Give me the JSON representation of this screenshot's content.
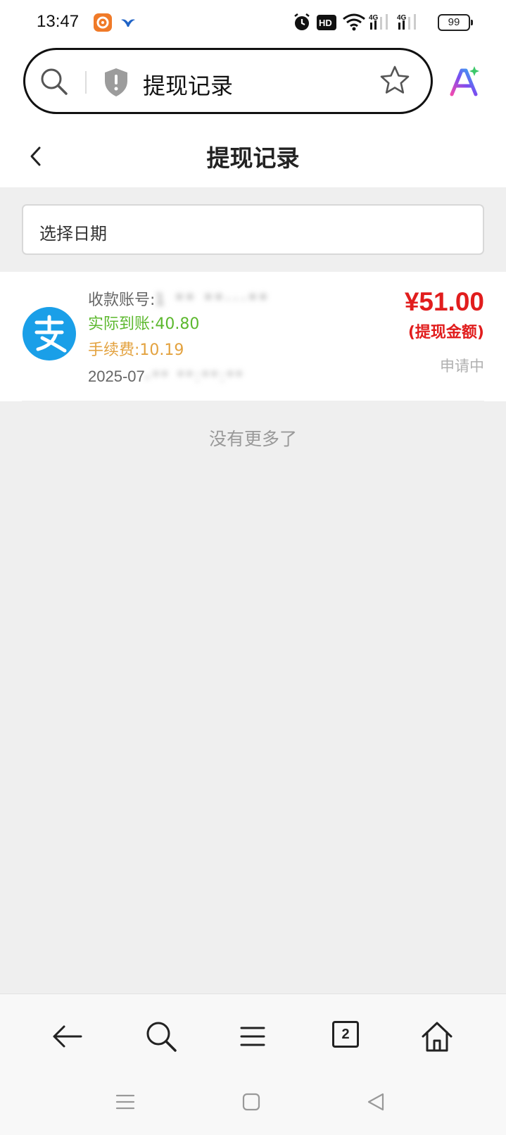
{
  "status_bar": {
    "time": "13:47",
    "battery": "99",
    "icons": [
      "app-notification-icon",
      "bird-notification-icon",
      "alarm-icon",
      "hd-icon",
      "wifi-icon",
      "signal-4g-icon",
      "signal-4g-icon"
    ],
    "hd_label": "HD",
    "net_label_1": "4G",
    "net_label_2": "4G"
  },
  "browser": {
    "address_text": "提现记录",
    "tab_count": "2"
  },
  "page": {
    "title": "提现记录",
    "date_placeholder": "选择日期"
  },
  "record": {
    "account_label": "收款账号:",
    "account_value": "1 ** **···**",
    "actual_label": "实际到账:",
    "actual_value": "40.80",
    "fee_label": "手续费:",
    "fee_value": "10.19",
    "date_prefix": "2025-07",
    "date_blurred": "-** **:**:**",
    "amount": "¥51.00",
    "amount_label": "(提现金额)",
    "status": "申请中"
  },
  "footer": {
    "no_more": "没有更多了"
  },
  "colors": {
    "amount_red": "#e11d1d",
    "actual_green": "#5cb82e",
    "fee_orange": "#e3a23f",
    "alipay_blue": "#1a9fe8"
  }
}
